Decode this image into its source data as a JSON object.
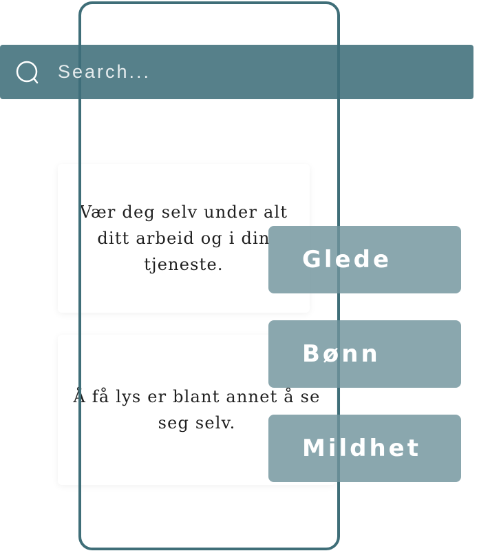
{
  "search": {
    "placeholder": "Search..."
  },
  "cards": [
    {
      "text": "Vær deg selv under alt ditt arbeid og i din tjeneste."
    },
    {
      "text": "Å få lys er blant annet å se seg selv."
    }
  ],
  "tags": [
    {
      "label": "Glede"
    },
    {
      "label": "Bønn"
    },
    {
      "label": "Mildhet"
    }
  ],
  "colors": {
    "search_bar": "#4a7a84",
    "frame": "#3f6e78",
    "tag": "#8ca7ae",
    "card_text": "#1f1f1f"
  },
  "icons": {
    "search": "search-icon"
  }
}
